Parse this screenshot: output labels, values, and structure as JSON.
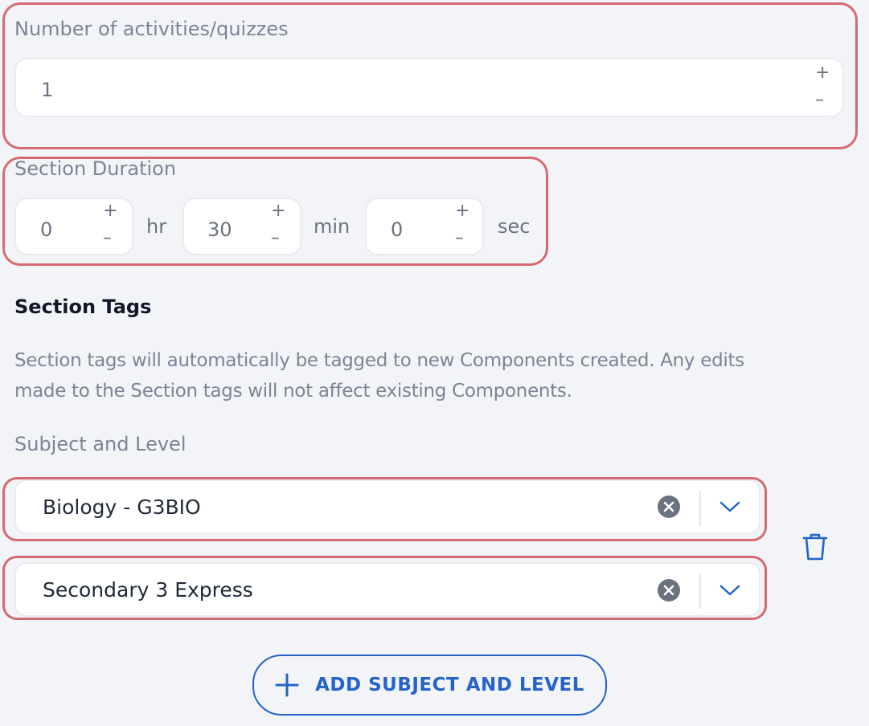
{
  "activities": {
    "label": "Number of activities/quizzes",
    "value": "1"
  },
  "duration": {
    "label": "Section Duration",
    "hours": "0",
    "hours_unit": "hr",
    "minutes": "30",
    "minutes_unit": "min",
    "seconds": "0",
    "seconds_unit": "sec"
  },
  "tags": {
    "title": "Section Tags",
    "description_line1": "Section tags will automatically be tagged to new Components created. Any edits",
    "description_line2": "made to the Section tags will not affect existing Components.",
    "subject_level_label": "Subject and Level",
    "subject_value": "Biology - G3BIO",
    "level_value": "Secondary 3 Express"
  },
  "add_button_label": "ADD SUBJECT AND LEVEL",
  "icons": {
    "increment": "plus-icon",
    "decrement": "minus-icon",
    "clear": "clear-circle-icon",
    "dropdown": "chevron-down-icon",
    "delete": "trash-icon",
    "add": "plus-icon"
  },
  "colors": {
    "highlight": "#d56a70",
    "accent": "#2563c9",
    "background": "#f3f4f8"
  }
}
